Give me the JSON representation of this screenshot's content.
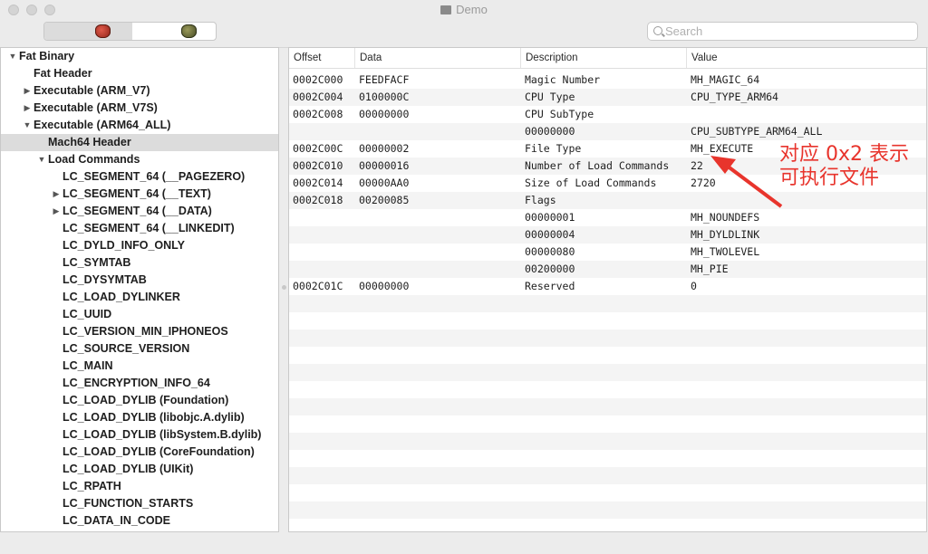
{
  "window": {
    "title": "Demo"
  },
  "toolbar": {
    "search_placeholder": "Search",
    "segment_left_icon": "red-apple-app-icon",
    "segment_right_icon": "green-apple-app-icon"
  },
  "outline": {
    "items": [
      {
        "label": "Fat Binary",
        "level": 0,
        "disclosure": "open",
        "selected": false
      },
      {
        "label": "Fat Header",
        "level": 1,
        "disclosure": "none",
        "selected": false
      },
      {
        "label": "Executable  (ARM_V7)",
        "level": 1,
        "disclosure": "closed",
        "selected": false
      },
      {
        "label": "Executable  (ARM_V7S)",
        "level": 1,
        "disclosure": "closed",
        "selected": false
      },
      {
        "label": "Executable  (ARM64_ALL)",
        "level": 1,
        "disclosure": "open",
        "selected": false
      },
      {
        "label": "Mach64 Header",
        "level": 2,
        "disclosure": "none",
        "selected": true
      },
      {
        "label": "Load Commands",
        "level": 2,
        "disclosure": "open",
        "selected": false
      },
      {
        "label": "LC_SEGMENT_64 (__PAGEZERO)",
        "level": 3,
        "disclosure": "none",
        "selected": false
      },
      {
        "label": "LC_SEGMENT_64 (__TEXT)",
        "level": 3,
        "disclosure": "closed",
        "selected": false
      },
      {
        "label": "LC_SEGMENT_64 (__DATA)",
        "level": 3,
        "disclosure": "closed",
        "selected": false
      },
      {
        "label": "LC_SEGMENT_64 (__LINKEDIT)",
        "level": 3,
        "disclosure": "none",
        "selected": false
      },
      {
        "label": "LC_DYLD_INFO_ONLY",
        "level": 3,
        "disclosure": "none",
        "selected": false
      },
      {
        "label": "LC_SYMTAB",
        "level": 3,
        "disclosure": "none",
        "selected": false
      },
      {
        "label": "LC_DYSYMTAB",
        "level": 3,
        "disclosure": "none",
        "selected": false
      },
      {
        "label": "LC_LOAD_DYLINKER",
        "level": 3,
        "disclosure": "none",
        "selected": false
      },
      {
        "label": "LC_UUID",
        "level": 3,
        "disclosure": "none",
        "selected": false
      },
      {
        "label": "LC_VERSION_MIN_IPHONEOS",
        "level": 3,
        "disclosure": "none",
        "selected": false
      },
      {
        "label": "LC_SOURCE_VERSION",
        "level": 3,
        "disclosure": "none",
        "selected": false
      },
      {
        "label": "LC_MAIN",
        "level": 3,
        "disclosure": "none",
        "selected": false
      },
      {
        "label": "LC_ENCRYPTION_INFO_64",
        "level": 3,
        "disclosure": "none",
        "selected": false
      },
      {
        "label": "LC_LOAD_DYLIB (Foundation)",
        "level": 3,
        "disclosure": "none",
        "selected": false
      },
      {
        "label": "LC_LOAD_DYLIB (libobjc.A.dylib)",
        "level": 3,
        "disclosure": "none",
        "selected": false
      },
      {
        "label": "LC_LOAD_DYLIB (libSystem.B.dylib)",
        "level": 3,
        "disclosure": "none",
        "selected": false
      },
      {
        "label": "LC_LOAD_DYLIB (CoreFoundation)",
        "level": 3,
        "disclosure": "none",
        "selected": false
      },
      {
        "label": "LC_LOAD_DYLIB (UIKit)",
        "level": 3,
        "disclosure": "none",
        "selected": false
      },
      {
        "label": "LC_RPATH",
        "level": 3,
        "disclosure": "none",
        "selected": false
      },
      {
        "label": "LC_FUNCTION_STARTS",
        "level": 3,
        "disclosure": "none",
        "selected": false
      },
      {
        "label": "LC_DATA_IN_CODE",
        "level": 3,
        "disclosure": "none",
        "selected": false
      }
    ]
  },
  "table": {
    "columns": [
      "Offset",
      "Data",
      "Description",
      "Value"
    ],
    "rows": [
      {
        "offset": "0002C000",
        "data": "FEEDFACF",
        "description": "Magic Number",
        "value": "MH_MAGIC_64"
      },
      {
        "offset": "0002C004",
        "data": "0100000C",
        "description": "CPU Type",
        "value": "CPU_TYPE_ARM64"
      },
      {
        "offset": "0002C008",
        "data": "00000000",
        "description": "CPU SubType",
        "value": ""
      },
      {
        "offset": "",
        "data": "",
        "description": "00000000",
        "value": "CPU_SUBTYPE_ARM64_ALL"
      },
      {
        "offset": "0002C00C",
        "data": "00000002",
        "description": "File Type",
        "value": "MH_EXECUTE"
      },
      {
        "offset": "0002C010",
        "data": "00000016",
        "description": "Number of Load Commands",
        "value": "22"
      },
      {
        "offset": "0002C014",
        "data": "00000AA0",
        "description": "Size of Load Commands",
        "value": "2720"
      },
      {
        "offset": "0002C018",
        "data": "00200085",
        "description": "Flags",
        "value": ""
      },
      {
        "offset": "",
        "data": "",
        "description": "00000001",
        "value": "MH_NOUNDEFS"
      },
      {
        "offset": "",
        "data": "",
        "description": "00000004",
        "value": "MH_DYLDLINK"
      },
      {
        "offset": "",
        "data": "",
        "description": "00000080",
        "value": "MH_TWOLEVEL"
      },
      {
        "offset": "",
        "data": "",
        "description": "00200000",
        "value": "MH_PIE"
      },
      {
        "offset": "0002C01C",
        "data": "00000000",
        "description": "Reserved",
        "value": "0"
      }
    ]
  },
  "annotation": {
    "line1": "对应 0x2 表示",
    "line2": "可执行文件",
    "color": "#e8342c"
  }
}
